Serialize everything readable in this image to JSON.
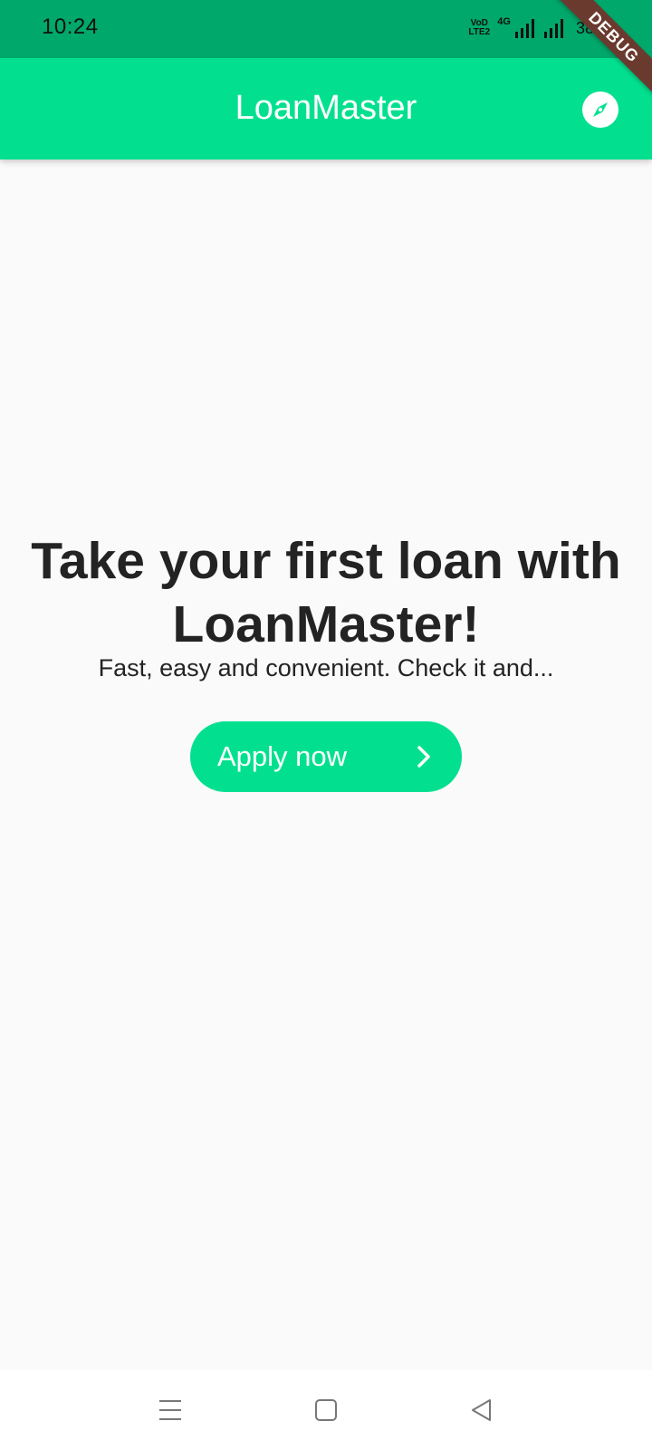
{
  "status_bar": {
    "time": "10:24",
    "volte_label": "VoD LTE2",
    "network_label": "4G",
    "battery": "38%"
  },
  "debug_ribbon": {
    "label": "DEBUG"
  },
  "app_bar": {
    "title": "LoanMaster",
    "action_icon": "compass-icon"
  },
  "main": {
    "headline": "Take your first loan with LoanMaster!",
    "subtitle": "Fast, easy and convenient. Check it and...",
    "apply_button": {
      "label": "Apply now",
      "icon": "chevron-right-icon"
    }
  },
  "nav_bar": {
    "buttons": [
      "menu-icon",
      "home-icon",
      "back-icon"
    ]
  },
  "colors": {
    "status_bar": "#01a86b",
    "primary": "#02e08f",
    "background": "#fafafa",
    "text": "#232323",
    "debug_ribbon": "#6b3a2e"
  }
}
